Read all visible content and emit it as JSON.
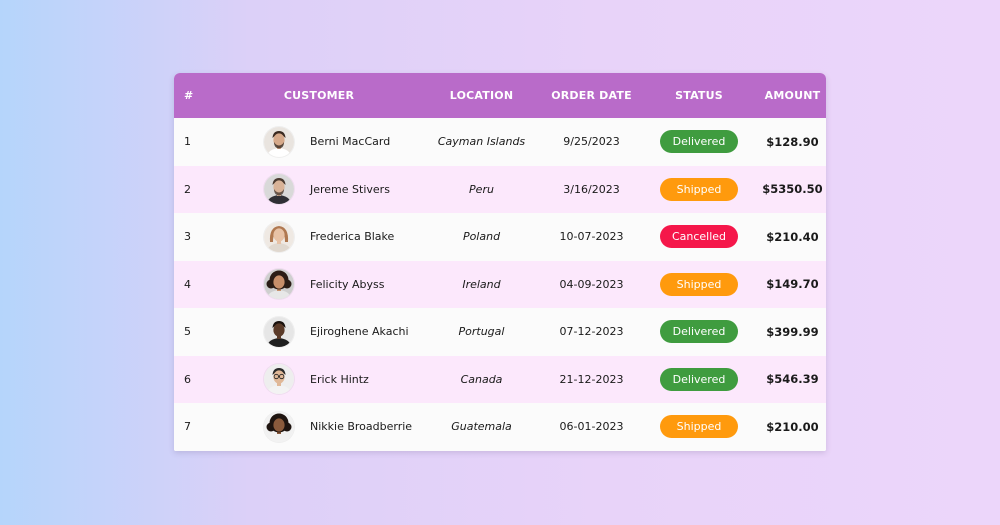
{
  "table": {
    "headers": {
      "num": "#",
      "customer": "CUSTOMER",
      "location": "LOCATION",
      "order_date": "ORDER DATE",
      "status": "STATUS",
      "amount": "AMOUNT"
    },
    "rows": [
      {
        "num": "1",
        "customer": "Berni MacCard",
        "location": "Cayman Islands",
        "order_date": "9/25/2023",
        "status": "Delivered",
        "amount": "$128.90"
      },
      {
        "num": "2",
        "customer": "Jereme Stivers",
        "location": "Peru",
        "order_date": "3/16/2023",
        "status": "Shipped",
        "amount": "$5350.50"
      },
      {
        "num": "3",
        "customer": "Frederica Blake",
        "location": "Poland",
        "order_date": "10-07-2023",
        "status": "Cancelled",
        "amount": "$210.40"
      },
      {
        "num": "4",
        "customer": "Felicity Abyss",
        "location": "Ireland",
        "order_date": "04-09-2023",
        "status": "Shipped",
        "amount": "$149.70"
      },
      {
        "num": "5",
        "customer": "Ejiroghene Akachi",
        "location": "Portugal",
        "order_date": "07-12-2023",
        "status": "Delivered",
        "amount": "$399.99"
      },
      {
        "num": "6",
        "customer": "Erick Hintz",
        "location": "Canada",
        "order_date": "21-12-2023",
        "status": "Delivered",
        "amount": "$546.39"
      },
      {
        "num": "7",
        "customer": "Nikkie Broadberrie",
        "location": "Guatemala",
        "order_date": "06-01-2023",
        "status": "Shipped",
        "amount": "$210.00"
      }
    ]
  },
  "colors": {
    "header_bg": "#b96bc9",
    "row_even_bg": "#fce8fc",
    "row_odd_bg": "#fbfbfb",
    "delivered": "#3f9c3f",
    "shipped": "#ff9a0d",
    "cancelled": "#f5174a"
  },
  "avatars": [
    {
      "icon": "avatar-man-beard-icon",
      "skin": "#d6a98a",
      "hair": "#3a2a20",
      "shirt": "#ffffff",
      "bg": "#e9e4df"
    },
    {
      "icon": "avatar-man-beard-icon",
      "skin": "#d9b398",
      "hair": "#4a3a30",
      "shirt": "#2f2f35",
      "bg": "#d9d9d9"
    },
    {
      "icon": "avatar-woman-icon",
      "skin": "#e8c2a6",
      "hair": "#b07850",
      "shirt": "#e0d8cf",
      "bg": "#efe9e3"
    },
    {
      "icon": "avatar-woman-curly-icon",
      "skin": "#c78f6a",
      "hair": "#2b1d16",
      "shirt": "#e7e7e7",
      "bg": "#cfcfcf"
    },
    {
      "icon": "avatar-man-icon",
      "skin": "#5a3a28",
      "hair": "#1a120e",
      "shirt": "#1f1f1f",
      "bg": "#e6e6e6"
    },
    {
      "icon": "avatar-man-glasses-icon",
      "skin": "#e0b898",
      "hair": "#2a2a2a",
      "shirt": "#f3f3f3",
      "bg": "#eeeeee"
    },
    {
      "icon": "avatar-woman-curly-icon",
      "skin": "#8a5a3c",
      "hair": "#1e1410",
      "shirt": "#f2f2f2",
      "bg": "#f1f1f1"
    }
  ]
}
